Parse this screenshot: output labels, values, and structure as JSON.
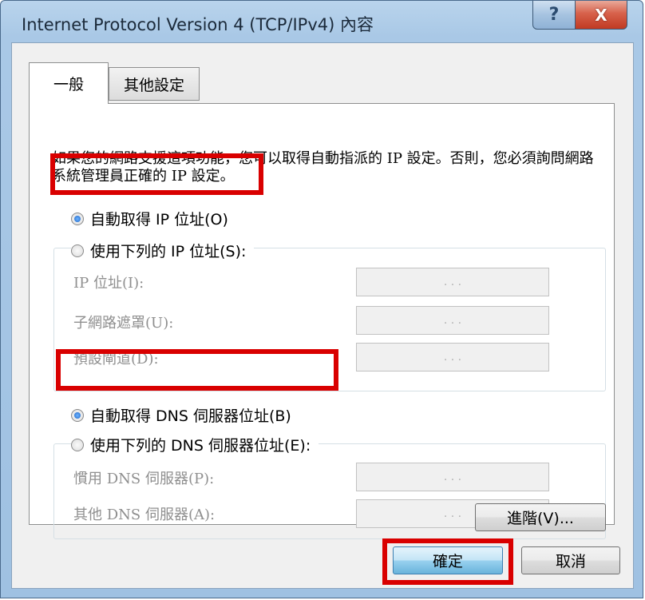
{
  "window": {
    "title": "Internet Protocol Version 4 (TCP/IPv4) 內容",
    "help_label": "?",
    "close_label": "X"
  },
  "tabs": [
    {
      "label": "一般",
      "selected": true
    },
    {
      "label": "其他設定",
      "selected": false
    }
  ],
  "description": "如果您的網路支援這項功能，您可以取得自動指派的 IP 設定。否則，您必須詢問網路系統管理員正確的 IP 設定。",
  "ip_options": {
    "auto": {
      "label": "自動取得 IP 位址(O)",
      "selected": true
    },
    "manual": {
      "label": "使用下列的 IP 位址(S):",
      "selected": false
    }
  },
  "ip_fields": [
    {
      "label": "IP 位址(I):",
      "value": ".   .   ."
    },
    {
      "label": "子網路遮罩(U):",
      "value": ".   .   ."
    },
    {
      "label": "預設閘道(D):",
      "value": ".   .   ."
    }
  ],
  "dns_options": {
    "auto": {
      "label": "自動取得 DNS 伺服器位址(B)",
      "selected": true
    },
    "manual": {
      "label": "使用下列的 DNS 伺服器位址(E):",
      "selected": false
    }
  },
  "dns_fields": [
    {
      "label": "慣用 DNS 伺服器(P):",
      "value": ".   .   ."
    },
    {
      "label": "其他 DNS 伺服器(A):",
      "value": ".   .   ."
    }
  ],
  "buttons": {
    "advanced": "進階(V)...",
    "ok": "確定",
    "cancel": "取消"
  },
  "colors": {
    "highlight": "#d90000",
    "radio_selected": "#1d66c8"
  }
}
